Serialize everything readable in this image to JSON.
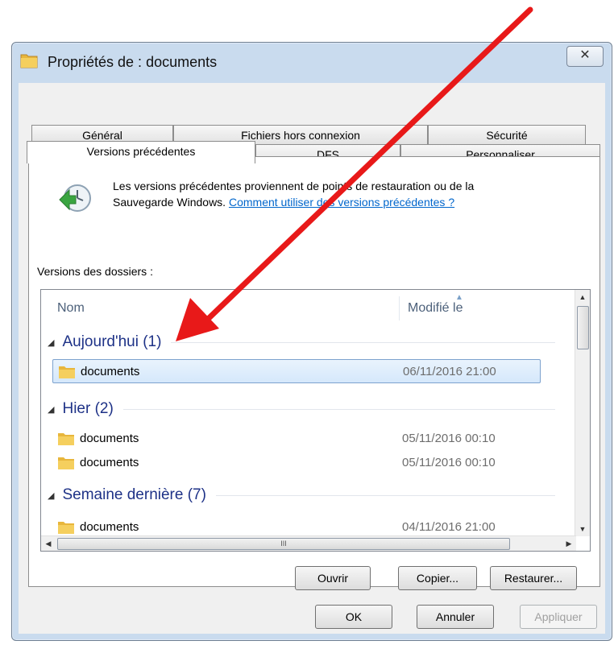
{
  "window": {
    "title": "Propriétés de : documents",
    "close_glyph": "✕"
  },
  "tabs": {
    "row1": [
      "Général",
      "Fichiers hors connexion",
      "Sécurité"
    ],
    "row2": [
      "Versions précédentes",
      "DFS",
      "Personnaliser"
    ],
    "active": "Versions précédentes"
  },
  "info": {
    "text_line1": "Les versions précédentes proviennent de points de restauration ou de la",
    "text_line2": "Sauvegarde Windows.",
    "link": "Comment utiliser des versions précédentes ?"
  },
  "versions_label": "Versions des dossiers :",
  "list": {
    "columns": {
      "name": "Nom",
      "modified": "Modifié le"
    },
    "groups": [
      {
        "label": "Aujourd'hui (1)"
      },
      {
        "label": "Hier (2)"
      },
      {
        "label": "Semaine dernière (7)"
      }
    ],
    "rows": [
      {
        "name": "documents",
        "date": "06/11/2016 21:00",
        "selected": true
      },
      {
        "name": "documents",
        "date": "05/11/2016 00:10"
      },
      {
        "name": "documents",
        "date": "05/11/2016 00:10"
      },
      {
        "name": "documents",
        "date": "04/11/2016 21:00"
      }
    ],
    "hscroll_grip": "III"
  },
  "panel_buttons": {
    "open": "Ouvrir",
    "copy": "Copier...",
    "restore": "Restaurer..."
  },
  "dialog_buttons": {
    "ok": "OK",
    "cancel": "Annuler",
    "apply": "Appliquer"
  },
  "colors": {
    "annotation_arrow": "#e81919",
    "selection": "#d5e8fb",
    "group_header": "#1e3287",
    "link": "#0066cc"
  }
}
